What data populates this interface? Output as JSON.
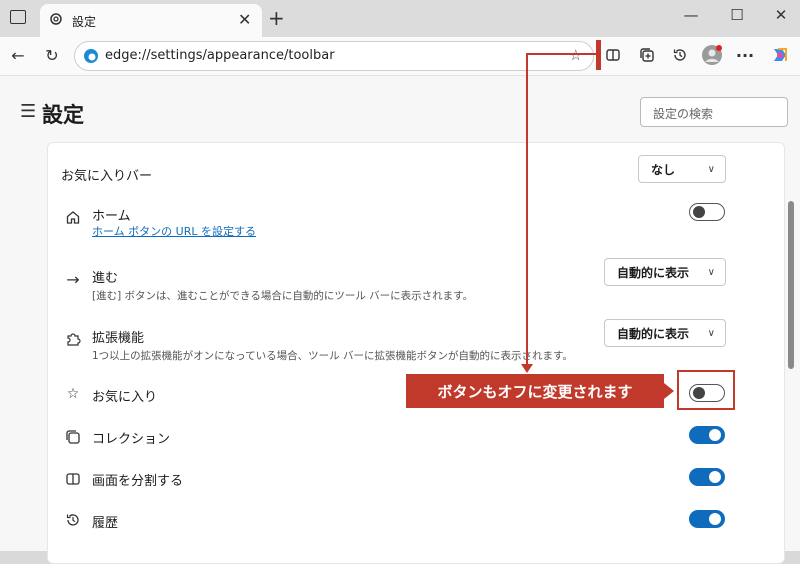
{
  "tab": {
    "title": "設定",
    "close": "✕",
    "new_tab": "+"
  },
  "window": {
    "minimize": "—",
    "maximize": "☐",
    "close": "✕"
  },
  "address": {
    "url": "edge://settings/appearance/toolbar"
  },
  "toolbar_more": "···",
  "settings": {
    "title": "設定",
    "search_placeholder": "設定の検索"
  },
  "rows": {
    "favorites_bar": {
      "label": "お気に入りバー",
      "value": "なし"
    },
    "home": {
      "label": "ホーム",
      "link": "ホーム ボタンの URL を設定する",
      "enabled": false
    },
    "forward": {
      "label": "進む",
      "desc": "[進む] ボタンは、進むことができる場合に自動的にツール バーに表示されます。",
      "value": "自動的に表示"
    },
    "extensions": {
      "label": "拡張機能",
      "desc": "1つ以上の拡張機能がオンになっている場合、ツール バーに拡張機能ボタンが自動的に表示されます。",
      "value": "自動的に表示"
    },
    "favorites": {
      "label": "お気に入り",
      "enabled": false
    },
    "collections": {
      "label": "コレクション",
      "enabled": true
    },
    "split_screen": {
      "label": "画面を分割する",
      "enabled": true
    },
    "history": {
      "label": "履歴",
      "enabled": true
    }
  },
  "annotation": {
    "text": "ボタンもオフに変更されます",
    "color": "#c0392b"
  },
  "colors": {
    "accent": "#0f6cbd"
  }
}
